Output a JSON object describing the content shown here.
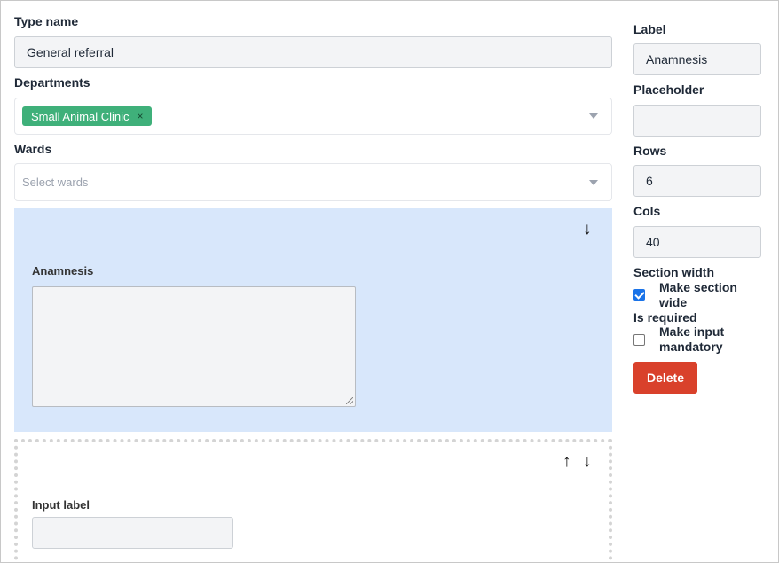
{
  "form": {
    "type_name_label": "Type name",
    "type_name_value": "General referral",
    "departments_label": "Departments",
    "departments_selected": [
      {
        "name": "Small Animal Clinic",
        "remove_glyph": "×",
        "color": "#3fb07a"
      }
    ],
    "wards_label": "Wards",
    "wards_placeholder": "Select wards"
  },
  "sections": [
    {
      "label": "Anamnesis",
      "active": true,
      "active_color": "#d8e7fb",
      "controls": {
        "down": "↓"
      }
    },
    {
      "label": "Input label",
      "active": false,
      "controls": {
        "up": "↑",
        "down": "↓"
      }
    }
  ],
  "properties": {
    "label_label": "Label",
    "label_value": "Anamnesis",
    "placeholder_label": "Placeholder",
    "placeholder_value": "",
    "rows_label": "Rows",
    "rows_value": "6",
    "cols_label": "Cols",
    "cols_value": "40",
    "section_width_label": "Section width",
    "make_wide_text": "Make section wide",
    "make_wide_checked": true,
    "is_required_label": "Is required",
    "mandatory_text": "Make input mandatory",
    "mandatory_checked": false,
    "delete_label": "Delete",
    "delete_color": "#d9412b"
  },
  "icons": {
    "caret": "chevron-down-icon",
    "arrow_up": "arrow-up-icon",
    "arrow_down": "arrow-down-icon"
  }
}
